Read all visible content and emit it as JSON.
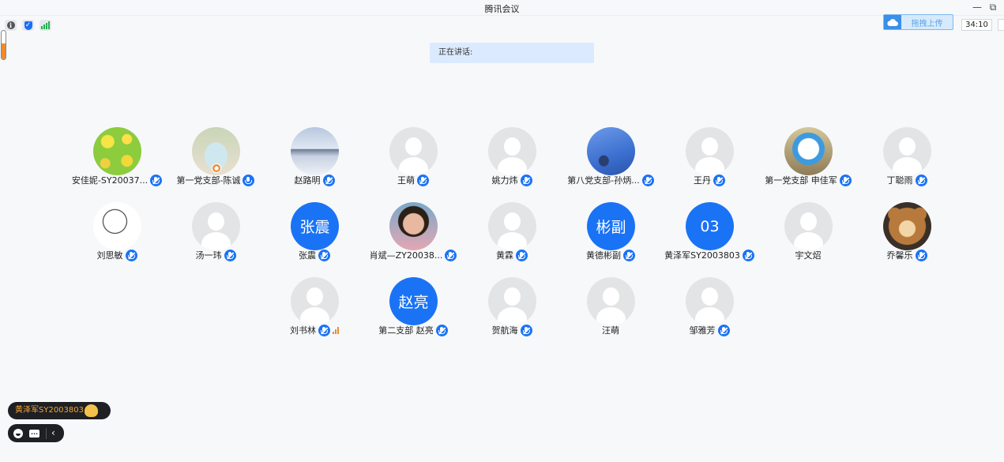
{
  "window": {
    "title": "腾讯会议"
  },
  "toolbar": {
    "info_icon": "info-icon",
    "security_icon": "shield-icon",
    "signal_icon": "network-signal-icon"
  },
  "upload": {
    "label": "拖拽上传",
    "icon": "cloud-icon"
  },
  "timer": "34:10",
  "speaking": {
    "label": "正在讲话:"
  },
  "volume_level": 0.55,
  "participants": [
    {
      "name": "安佳妮-SY20037...",
      "avatar": "photo-flower",
      "mic": "muted"
    },
    {
      "name": "第一党支部-陈诚",
      "avatar": "photo-mask",
      "mic": "active",
      "host": true
    },
    {
      "name": "赵路明",
      "avatar": "photo-plane",
      "mic": "muted"
    },
    {
      "name": "王萌",
      "avatar": "default",
      "mic": "muted"
    },
    {
      "name": "姚力炜",
      "avatar": "default",
      "mic": "muted"
    },
    {
      "name": "第八党支部-孙炳...",
      "avatar": "photo-sky",
      "mic": "muted"
    },
    {
      "name": "王丹",
      "avatar": "default",
      "mic": "muted"
    },
    {
      "name": "第一党支部 申佳军",
      "avatar": "photo-cat",
      "mic": "muted"
    },
    {
      "name": "丁聪雨",
      "avatar": "default",
      "mic": "muted"
    },
    {
      "name": "刘思敏",
      "avatar": "photo-sketch",
      "mic": "muted"
    },
    {
      "name": "汤一玮",
      "avatar": "default",
      "mic": "muted"
    },
    {
      "name": "张震",
      "avatar": "text",
      "avatar_text": "张震",
      "mic": "muted"
    },
    {
      "name": "肖斌—ZY20038...",
      "avatar": "photo-girl",
      "mic": "muted"
    },
    {
      "name": "黄霖",
      "avatar": "default",
      "mic": "muted"
    },
    {
      "name": "黄德彬副",
      "avatar": "text",
      "avatar_text": "彬副",
      "mic": "muted"
    },
    {
      "name": "黄泽军SY2003803",
      "avatar": "text",
      "avatar_text": "03",
      "mic": "muted"
    },
    {
      "name": "宇文炤",
      "avatar": "default",
      "mic": "none"
    },
    {
      "name": "乔馨乐",
      "avatar": "photo-bear",
      "mic": "muted"
    },
    {
      "name": "刘书林",
      "avatar": "default",
      "mic": "muted",
      "signal": true
    },
    {
      "name": "第二支部 赵亮",
      "avatar": "text",
      "avatar_text": "赵亮",
      "mic": "muted"
    },
    {
      "name": "贺航海",
      "avatar": "default",
      "mic": "muted"
    },
    {
      "name": "汪萌",
      "avatar": "default",
      "mic": "none"
    },
    {
      "name": "邹雅芳",
      "avatar": "default",
      "mic": "muted"
    }
  ],
  "reaction_toast": {
    "name": "黄泽军SY2003803",
    "emoji": "clapping-hands-icon"
  },
  "colors": {
    "accent": "#1a73f5",
    "toast_text": "#f3a53a",
    "speaking_bg": "#dceaff"
  }
}
